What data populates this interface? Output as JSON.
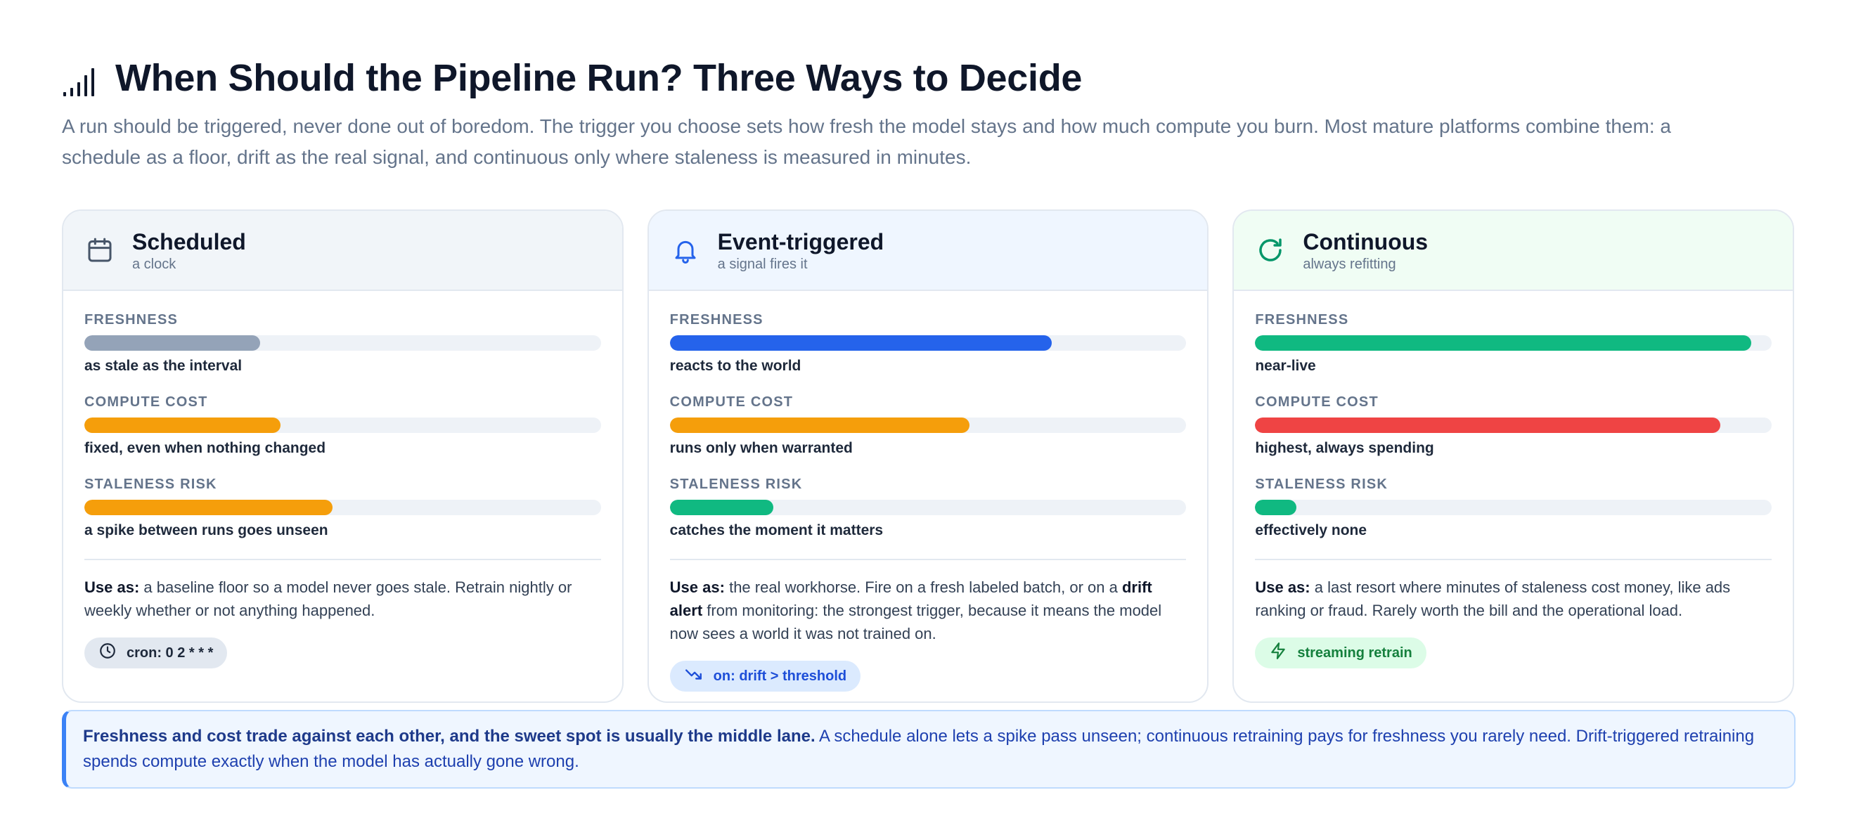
{
  "header": {
    "title": "When Should the Pipeline Run? Three Ways to Decide",
    "subtitle": "A run should be triggered, never done out of boredom. The trigger you choose sets how fresh the model stays and how much compute you burn. Most mature platforms combine them: a schedule as a floor, drift as the real signal, and continuous only where staleness is measured in minutes.",
    "icon": "signal-bars-icon"
  },
  "colors": {
    "gray": "#94a3b8",
    "amber": "#f59e0b",
    "blue": "#2563eb",
    "green": "#10b981",
    "red": "#ef4444"
  },
  "cards": [
    {
      "name": "Scheduled",
      "tag": "a clock",
      "icon": "calendar-icon",
      "metrics": [
        {
          "label": "FRESHNESS",
          "note": "as stale as the interval",
          "level": 0.34,
          "color": "#94a3b8"
        },
        {
          "label": "COMPUTE COST",
          "note": "fixed, even when nothing changed",
          "level": 0.38,
          "color": "#f59e0b"
        },
        {
          "label": "STALENESS RISK",
          "note": "a spike between runs goes unseen",
          "level": 0.48,
          "color": "#f59e0b"
        }
      ],
      "use_label": "Use as:",
      "use_text": "a baseline floor so a model never goes stale. Retrain nightly or weekly whether or not anything happened.",
      "pill": {
        "icon": "clock-icon",
        "text": "cron: 0 2 * * *"
      }
    },
    {
      "name": "Event-triggered",
      "tag": "a signal fires it",
      "icon": "bell-icon",
      "metrics": [
        {
          "label": "FRESHNESS",
          "note": "reacts to the world",
          "level": 0.74,
          "color": "#2563eb"
        },
        {
          "label": "COMPUTE COST",
          "note": "runs only when warranted",
          "level": 0.58,
          "color": "#f59e0b"
        },
        {
          "label": "STALENESS RISK",
          "note": "catches the moment it matters",
          "level": 0.2,
          "color": "#10b981"
        }
      ],
      "use_label": "Use as:",
      "use_text_1": "the real workhorse. Fire on a fresh labeled batch, or on a",
      "use_bold": "drift alert",
      "use_text_2": "from monitoring: the strongest trigger, because it means the model now sees a world it was not trained on.",
      "pill": {
        "icon": "trend-down-icon",
        "text": "on: drift > threshold"
      }
    },
    {
      "name": "Continuous",
      "tag": "always refitting",
      "icon": "refresh-icon",
      "metrics": [
        {
          "label": "FRESHNESS",
          "note": "near-live",
          "level": 0.96,
          "color": "#10b981"
        },
        {
          "label": "COMPUTE COST",
          "note": "highest, always spending",
          "level": 0.9,
          "color": "#ef4444"
        },
        {
          "label": "STALENESS RISK",
          "note": "effectively none",
          "level": 0.08,
          "color": "#10b981"
        }
      ],
      "use_label": "Use as:",
      "use_text": "a last resort where minutes of staleness cost money, like ads ranking or fraud. Rarely worth the bill and the operational load.",
      "pill": {
        "icon": "lightning-icon",
        "text": "streaming retrain"
      }
    }
  ],
  "callout": {
    "bold": "Freshness and cost trade against each other, and the sweet spot is usually the middle lane.",
    "text": "A schedule alone lets a spike pass unseen; continuous retraining pays for freshness you rarely need. Drift-triggered retraining spends compute exactly when the model has actually gone wrong."
  }
}
